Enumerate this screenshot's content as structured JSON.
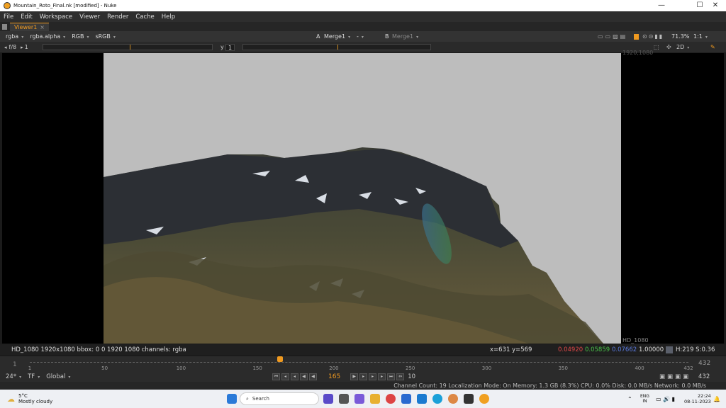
{
  "window": {
    "title": "Mountain_Roto_Final.nk [modified] - Nuke",
    "minimize": "—",
    "maximize": "☐",
    "close": "✕"
  },
  "menu": [
    "File",
    "Edit",
    "Workspace",
    "Viewer",
    "Render",
    "Cache",
    "Help"
  ],
  "tab": {
    "label": "Viewer1",
    "close": "×"
  },
  "toolbar": {
    "channels": "rgba",
    "alpha": "rgba.alpha",
    "rgb": "RGB",
    "colorspace": "sRGB",
    "a_input": "A",
    "a_node": "Merge1",
    "ab_op": "-",
    "b_input": "B",
    "b_node": "Merge1",
    "zoom": "71.3%",
    "ratio": "1:1"
  },
  "toolbar2": {
    "fstop": "f/8",
    "gain": "1",
    "gamma_label": "y",
    "gamma": "1",
    "mode": "2D"
  },
  "viewer": {
    "format_label_top": "1920,1080",
    "format_label_bottom": "HD_1080"
  },
  "infobar": {
    "left": "HD_1080 1920x1080  bbox: 0 0 1920 1080 channels: rgba",
    "coords": "x=631 y=569",
    "r": "0.04920",
    "g": "0.05859",
    "b": "0.07662",
    "a": "1.00000",
    "hs": "H:219 S:0.36"
  },
  "timeline": {
    "start": "1",
    "end": "432",
    "ticks": [
      "1",
      "50",
      "100",
      "150",
      "200",
      "250",
      "300",
      "350",
      "400",
      "432"
    ],
    "current_fraction": 0.38
  },
  "controls": {
    "fps": "24*",
    "tf": "TF",
    "global": "Global",
    "frame": "165",
    "increment": "10",
    "end": "432"
  },
  "status": "Channel Count: 19 Localization Mode: On Memory: 1.3 GB (8.3%) CPU: 0.0% Disk: 0.0 MB/s Network: 0.0 MB/s",
  "taskbar": {
    "temp": "5°C",
    "weather": "Mostly cloudy",
    "search": "Search",
    "lang1": "ENG",
    "lang2": "IN",
    "time": "22:24",
    "date": "08-11-2023"
  },
  "colors": {
    "accent": "#f09a20",
    "red": "#e04848",
    "green": "#48c048",
    "blue": "#5a7ae0"
  }
}
